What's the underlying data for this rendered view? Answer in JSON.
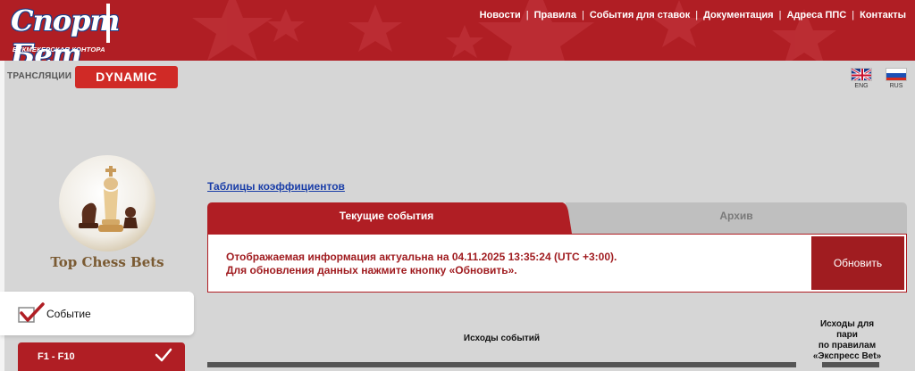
{
  "header": {
    "logo_main": "Спорт Бет",
    "logo_sub": "БУКМЕКЕРСКАЯ КОНТОРА",
    "nav": [
      {
        "label": "Новости"
      },
      {
        "label": "Правила"
      },
      {
        "label": "События для ставок"
      },
      {
        "label": "Документация"
      },
      {
        "label": "Адреса ППС"
      },
      {
        "label": "Контакты"
      }
    ],
    "separator": "|"
  },
  "subbar": {
    "translations_label": "ТРАНСЛЯЦИИ",
    "dynamic_label": "DYNAMIC",
    "languages": [
      {
        "code": "ENG",
        "icon": "uk-flag-icon"
      },
      {
        "code": "RUS",
        "icon": "russia-flag-icon"
      }
    ]
  },
  "sidebar": {
    "chess_title": "Top Chess Bets",
    "event_label": "Событие",
    "range_label": "F1 - F10"
  },
  "main": {
    "coef_link": "Таблицы коэффициентов",
    "tabs": [
      {
        "label": "Текущие события",
        "active": true
      },
      {
        "label": "Архив",
        "active": false
      }
    ],
    "info_line1": "Отображаемая информация актуальна на 04.11.2025 13:35:24 (UTC +3:00).",
    "info_line2": "Для обновления данных нажмите кнопку «Обновить».",
    "refresh_label": "Обновить",
    "col_outcomes": "Исходы событий",
    "col_pairs_1": "Исходы для",
    "col_pairs_2": "пари",
    "col_pairs_3": "по правилам",
    "col_pairs_4": "«Экспресс Bet»"
  },
  "colors": {
    "brand_red": "#b01e24",
    "dark_red": "#a01c20",
    "link_blue": "#1a3ea8",
    "background": "#d6d6d6"
  }
}
